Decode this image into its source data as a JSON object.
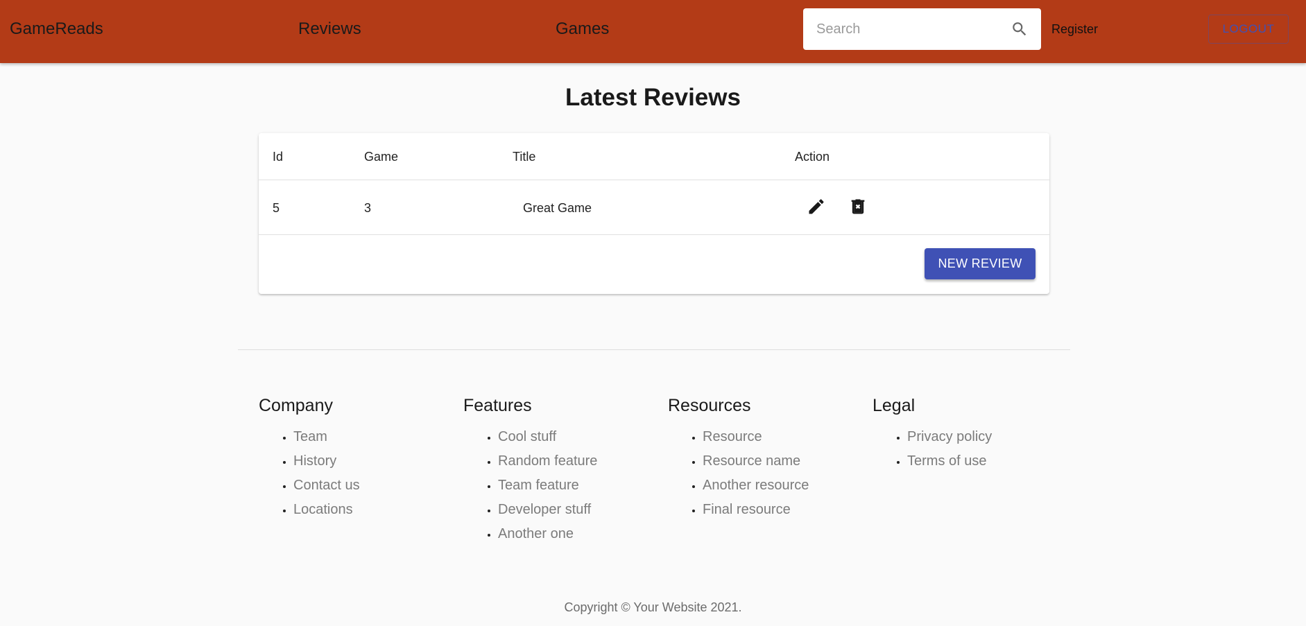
{
  "header": {
    "brand": "GameReads",
    "nav": [
      "Reviews",
      "Games"
    ],
    "search_placeholder": "Search",
    "register_label": "Register",
    "logout_label": "LOGOUT",
    "bar_color": "#b33b17",
    "accent_color": "#3f51b5"
  },
  "main": {
    "title": "Latest Reviews",
    "table": {
      "columns": [
        "Id",
        "Game",
        "Title",
        "Action"
      ],
      "rows": [
        {
          "id": "5",
          "game": "3",
          "title": "Great Game",
          "actions": [
            "edit-icon",
            "delete-icon"
          ]
        }
      ]
    },
    "new_review_label": "NEW REVIEW"
  },
  "footer": {
    "columns": [
      {
        "heading": "Company",
        "links": [
          "Team",
          "History",
          "Contact us",
          "Locations"
        ]
      },
      {
        "heading": "Features",
        "links": [
          "Cool stuff",
          "Random feature",
          "Team feature",
          "Developer stuff",
          "Another one"
        ]
      },
      {
        "heading": "Resources",
        "links": [
          "Resource",
          "Resource name",
          "Another resource",
          "Final resource"
        ]
      },
      {
        "heading": "Legal",
        "links": [
          "Privacy policy",
          "Terms of use"
        ]
      }
    ],
    "copyright": "Copyright © Your Website 2021."
  }
}
